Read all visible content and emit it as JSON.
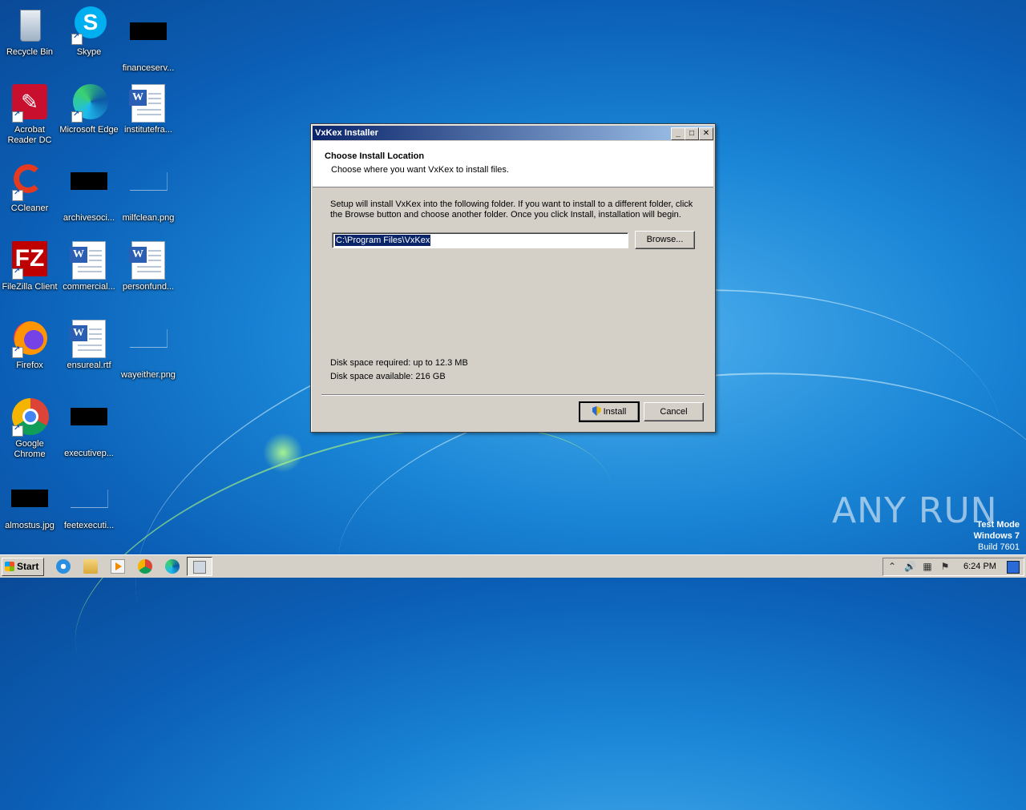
{
  "desktop": {
    "icons": [
      {
        "label": "Recycle Bin"
      },
      {
        "label": "Skype"
      },
      {
        "label": "financeserv..."
      },
      {
        "label": "Acrobat Reader DC"
      },
      {
        "label": "Microsoft Edge"
      },
      {
        "label": "institutefra..."
      },
      {
        "label": "CCleaner"
      },
      {
        "label": "archivesoci..."
      },
      {
        "label": "milfclean.png"
      },
      {
        "label": "FileZilla Client"
      },
      {
        "label": "commercial..."
      },
      {
        "label": "personfund..."
      },
      {
        "label": "Firefox"
      },
      {
        "label": "ensureal.rtf"
      },
      {
        "label": "wayeither.png"
      },
      {
        "label": "Google Chrome"
      },
      {
        "label": "executivep..."
      },
      {
        "label": "almostus.jpg"
      },
      {
        "label": "feetexecuti..."
      }
    ]
  },
  "installer": {
    "title": "VxKex Installer",
    "heading": "Choose Install Location",
    "subheading": "Choose where you want VxKex to install files.",
    "description": "Setup will install VxKex into the following folder. If you want to install to a different folder, click the Browse button and choose another folder. Once you click Install, installation will begin.",
    "path_value": "C:\\Program Files\\VxKex",
    "browse_label": "Browse...",
    "disk_required": "Disk space required: up to 12.3 MB",
    "disk_available": "Disk space available: 216 GB",
    "install_label": "Install",
    "cancel_label": "Cancel"
  },
  "taskbar": {
    "start_label": "Start",
    "clock": "6:24 PM"
  },
  "watermark": {
    "line1": "Test Mode",
    "line2": "Windows 7",
    "line3": "Build 7601",
    "brand": "ANY RUN"
  }
}
